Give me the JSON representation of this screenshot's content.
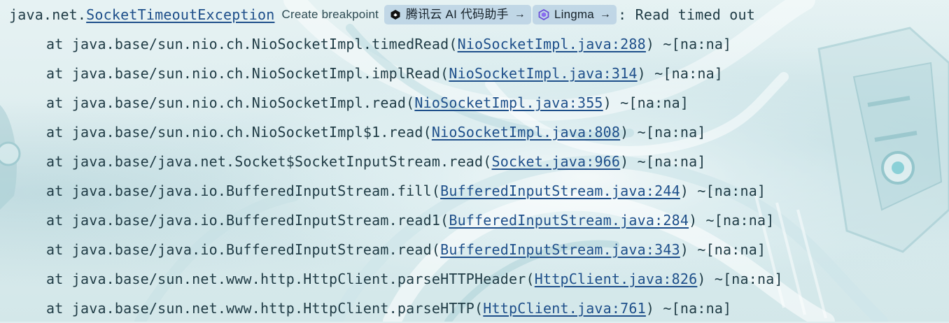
{
  "exception": {
    "prefix": "java.net.",
    "class_link": "SocketTimeoutException",
    "create_breakpoint": "Create breakpoint",
    "message": ": Read timed out"
  },
  "assistants": [
    {
      "label": "腾讯云 AI 代码助手",
      "arrow": "→",
      "icon": "hexagon-icon"
    },
    {
      "label": "Lingma",
      "arrow": "→",
      "icon": "lingma-icon"
    }
  ],
  "frames": [
    {
      "prefix": "at java.base/sun.nio.ch.NioSocketImpl.timedRead(",
      "link": "NioSocketImpl.java:288",
      "suffix": ") ~[na:na]"
    },
    {
      "prefix": "at java.base/sun.nio.ch.NioSocketImpl.implRead(",
      "link": "NioSocketImpl.java:314",
      "suffix": ") ~[na:na]"
    },
    {
      "prefix": "at java.base/sun.nio.ch.NioSocketImpl.read(",
      "link": "NioSocketImpl.java:355",
      "suffix": ") ~[na:na]"
    },
    {
      "prefix": "at java.base/sun.nio.ch.NioSocketImpl$1.read(",
      "link": "NioSocketImpl.java:808",
      "suffix": ") ~[na:na]"
    },
    {
      "prefix": "at java.base/java.net.Socket$SocketInputStream.read(",
      "link": "Socket.java:966",
      "suffix": ") ~[na:na]"
    },
    {
      "prefix": "at java.base/java.io.BufferedInputStream.fill(",
      "link": "BufferedInputStream.java:244",
      "suffix": ") ~[na:na]"
    },
    {
      "prefix": "at java.base/java.io.BufferedInputStream.read1(",
      "link": "BufferedInputStream.java:284",
      "suffix": ") ~[na:na]"
    },
    {
      "prefix": "at java.base/java.io.BufferedInputStream.read(",
      "link": "BufferedInputStream.java:343",
      "suffix": ") ~[na:na]"
    },
    {
      "prefix": "at java.base/sun.net.www.http.HttpClient.parseHTTPHeader(",
      "link": "HttpClient.java:826",
      "suffix": ") ~[na:na]"
    },
    {
      "prefix": "at java.base/sun.net.www.http.HttpClient.parseHTTP(",
      "link": "HttpClient.java:761",
      "suffix": ") ~[na:na]"
    }
  ],
  "colors": {
    "text": "#1f3b45",
    "link": "#1e4f8a",
    "chip_bg": "#b4cde1",
    "background": "#dfeef0"
  }
}
